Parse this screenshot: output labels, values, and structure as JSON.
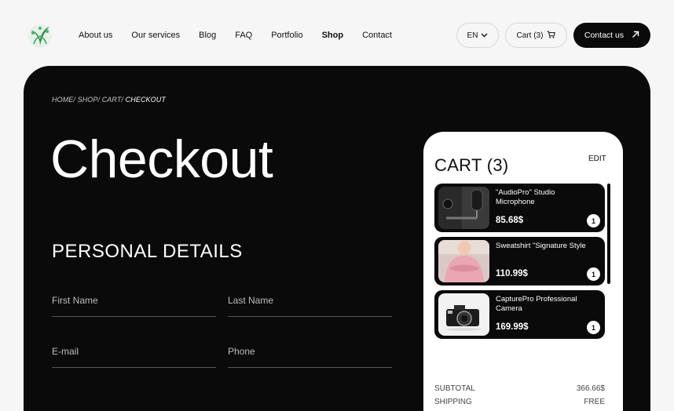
{
  "header": {
    "logo_icon": "leaf-sprout-logo",
    "nav": [
      {
        "label": "About us",
        "active": false
      },
      {
        "label": "Our services",
        "active": false
      },
      {
        "label": "Blog",
        "active": false
      },
      {
        "label": "FAQ",
        "active": false
      },
      {
        "label": "Portfolio",
        "active": false
      },
      {
        "label": "Shop",
        "active": true
      },
      {
        "label": "Contact",
        "active": false
      }
    ],
    "language": "EN",
    "cart_label": "Cart (3)",
    "contact_label": "Contact us"
  },
  "breadcrumb": {
    "path": "HOME/ SHOP/ CART/",
    "current": "CHECKOUT"
  },
  "page_title": "Checkout",
  "personal_details": {
    "title": "PERSONAL DETAILS",
    "first_name_placeholder": "First Name",
    "last_name_placeholder": "Last Name",
    "email_placeholder": "E-mail",
    "phone_placeholder": "Phone"
  },
  "cart": {
    "title": "CART (3)",
    "edit_label": "EDIT",
    "items": [
      {
        "name": "\"AudioPro\" Studio Microphone",
        "price": "85.68$",
        "qty": "1"
      },
      {
        "name": "Sweatshirt \"Signature Style",
        "price": "110.99$",
        "qty": "1"
      },
      {
        "name": "CapturePro Professional Camera",
        "price": "169.99$",
        "qty": "1"
      }
    ],
    "subtotal_label": "SUBTOTAL",
    "subtotal_value": "366.66$",
    "shipping_label": "SHIPPING",
    "shipping_value": "FREE"
  },
  "colors": {
    "background": "#f6f6f6",
    "panel": "#0a0a0a",
    "brand_green": "#2e8b4a"
  }
}
